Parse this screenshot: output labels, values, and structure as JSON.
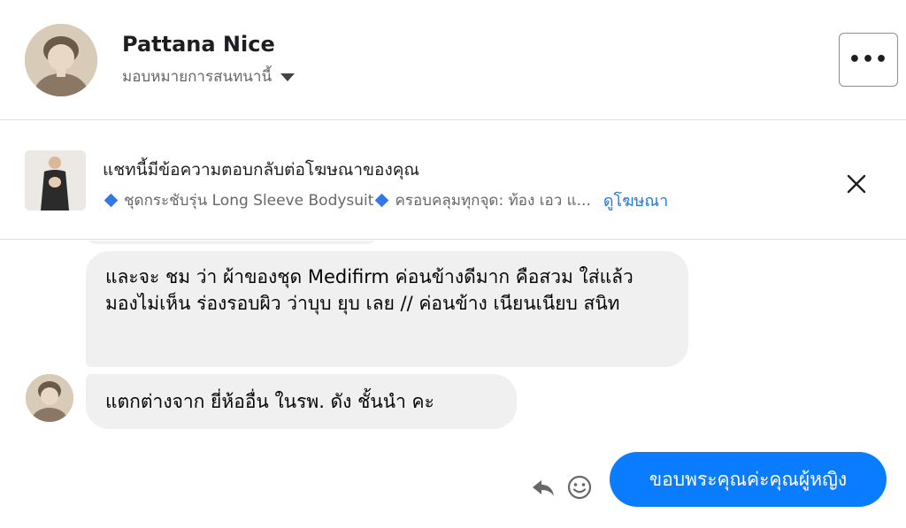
{
  "header": {
    "contact_name": "Pattana Nice",
    "subtitle": "มอบหมายการสนทนานี้",
    "more_label": "•••"
  },
  "banner": {
    "title": "แชทนี้มีข้อความตอบกลับต่อโฆษณาของคุณ",
    "ad_item_1": "ชุดกระชับรุ่น Long Sleeve Bodysuit",
    "ad_item_2": "ครอบคลุมทุกจุด: ท้อง เอว แ...",
    "see_ad_link": "ดูโฆษณา"
  },
  "messages": [
    {
      "direction": "incoming",
      "text": "และจะ ชม ว่า ผ้าของชุด Medifirm ค่อนข้างดีมาก คือสวม ใส่แล้ว มองไม่เห็น ร่องรอบผิว ว่าบุบ ยุบ เลย // ค่อนข้าง เนียนเนียบ สนิท"
    },
    {
      "direction": "incoming",
      "text": "แตกต่างจาก ยี่ห้ออื่น ในรพ. ดัง ชั้นนำ คะ"
    },
    {
      "direction": "outgoing",
      "text": "ขอบพระคุณค่ะคุณผู้หญิง"
    }
  ],
  "icons": {
    "more": "ellipsis-icon",
    "caret": "caret-down-icon",
    "close": "close-icon",
    "reply": "reply-icon",
    "react": "smiley-icon",
    "ad_bullet": "blue-diamond-icon"
  },
  "colors": {
    "accent": "#1877f2",
    "outgoing_bubble": "#0a7cff",
    "incoming_bubble": "#f0f0f0",
    "diamond": "#3578e5"
  }
}
